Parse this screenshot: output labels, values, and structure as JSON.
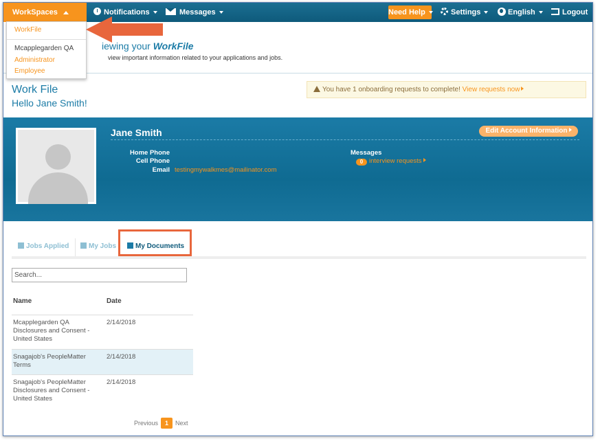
{
  "nav": {
    "workspaces": "WorkSpaces",
    "notifications": "Notifications",
    "messages": "Messages",
    "need_help": "Need Help",
    "settings": "Settings",
    "language": "English",
    "logout": "Logout"
  },
  "workspaces_menu": {
    "items": [
      "WorkFile",
      "Mcapplegarden QA",
      "Administrator",
      "Employee"
    ]
  },
  "header": {
    "title_prefix": "iewing your ",
    "title_em": "WorkFile",
    "subtitle": "view important information related to your applications and jobs."
  },
  "page": {
    "title": "Work File",
    "greeting": "Hello Jane Smith!"
  },
  "alert": {
    "text": "You have 1 onboarding requests to complete!",
    "link": "View requests now"
  },
  "profile": {
    "name": "Jane Smith",
    "edit_button": "Edit Account Information",
    "home_phone_label": "Home Phone",
    "cell_phone_label": "Cell Phone",
    "email_label": "Email",
    "email": "testingmywalkmes@mailinator.com",
    "messages_label": "Messages",
    "interview_count": "0",
    "interview_label": "interview requests"
  },
  "tabs": [
    {
      "label": "Jobs Applied"
    },
    {
      "label": "My Jobs"
    },
    {
      "label": "My Documents",
      "active": true
    }
  ],
  "search": {
    "placeholder": "Search..."
  },
  "table": {
    "headers": [
      "Name",
      "Date"
    ],
    "rows": [
      {
        "name": "Mcapplegarden QA Disclosures and Consent - United States",
        "date": "2/14/2018"
      },
      {
        "name": "Snagajob's PeopleMatter Terms",
        "date": "2/14/2018"
      },
      {
        "name": "Snagajob's PeopleMatter Disclosures and Consent - United States",
        "date": "2/14/2018"
      }
    ]
  },
  "pager": {
    "previous": "Previous",
    "current": "1",
    "next": "Next"
  },
  "colors": {
    "brand_blue": "#1b7ba6",
    "accent_orange": "#f7941d",
    "highlight": "#e8663c"
  }
}
